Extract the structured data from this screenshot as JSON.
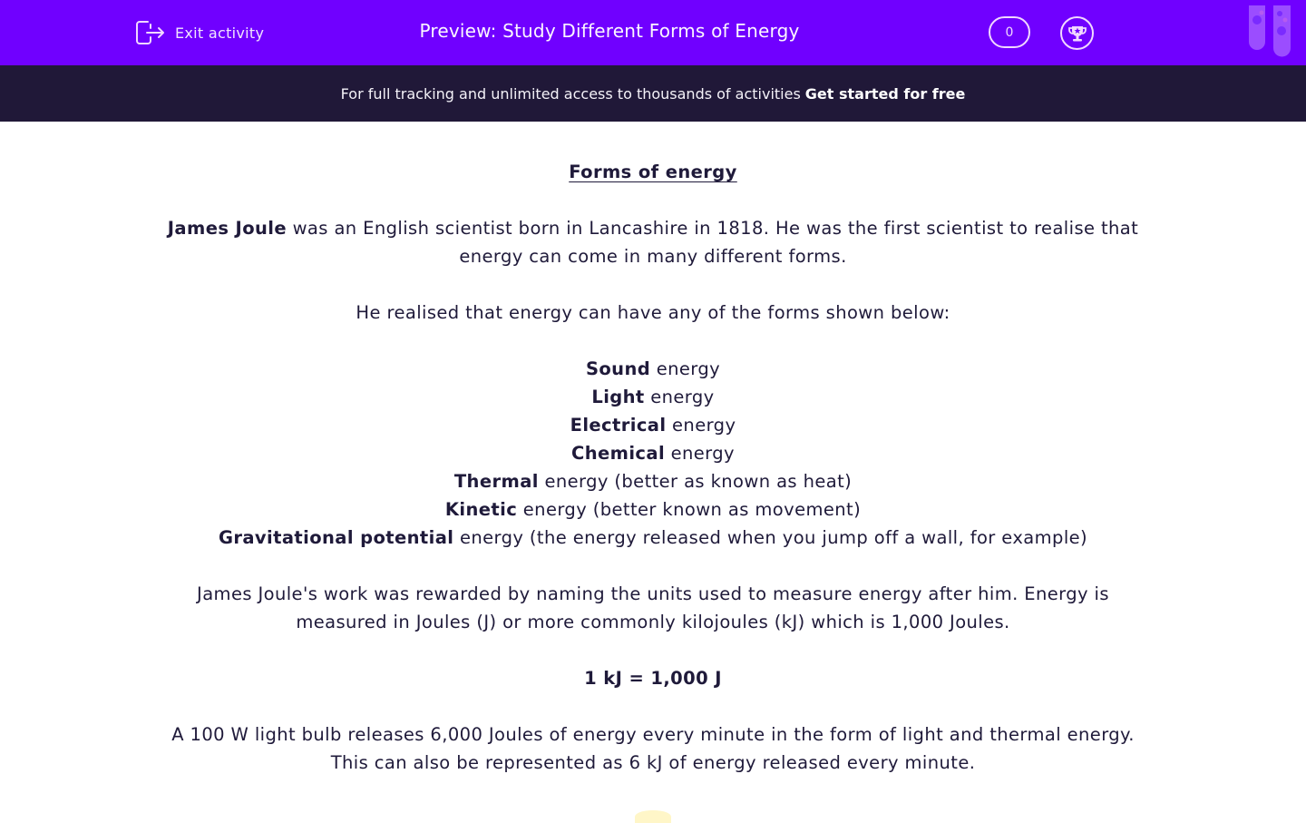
{
  "header": {
    "exit_label": "Exit activity",
    "title": "Preview: Study Different Forms of Energy",
    "score": "0",
    "icons": {
      "exit": "exit-arrow-icon",
      "trophy": "trophy-icon",
      "decoration": "test-tubes-icon"
    },
    "brand_color": "#7000ff"
  },
  "banner": {
    "text": "For full tracking and unlimited access to thousands of activities",
    "cta": "Get started for free",
    "background": "#201838"
  },
  "content": {
    "heading": "Forms of energy",
    "intro": {
      "bold": "James Joule",
      "line1": " was an English scientist born in Lancashire in 1818. He was the first scientist to realise that",
      "line2": "energy can come in many different forms."
    },
    "lead": "He realised that energy can have any of the forms shown below:",
    "forms": [
      {
        "bold": "Sound",
        "rest": " energy"
      },
      {
        "bold": "Light",
        "rest": " energy"
      },
      {
        "bold": "Electrical",
        "rest": " energy"
      },
      {
        "bold": "Chemical",
        "rest": " energy"
      },
      {
        "bold": "Thermal",
        "rest": " energy (better as known as heat)"
      },
      {
        "bold": "Kinetic",
        "rest": " energy (better known as movement)"
      },
      {
        "bold": "Gravitational potential",
        "rest": " energy (the energy released when you jump off a wall, for example)"
      }
    ],
    "units": {
      "line1": "James Joule's work was rewarded by naming the units used to measure energy after him.  Energy is",
      "line2": "measured in Joules (J) or more commonly kilojoules (kJ) which is 1,000 Joules."
    },
    "equation": "1 kJ = 1,000 J",
    "example": {
      "line1": "A 100 W light bulb releases 6,000 Joules of energy every minute in the form of light and thermal energy.",
      "line2": "This can also be represented as 6 kJ of energy released every minute."
    }
  }
}
